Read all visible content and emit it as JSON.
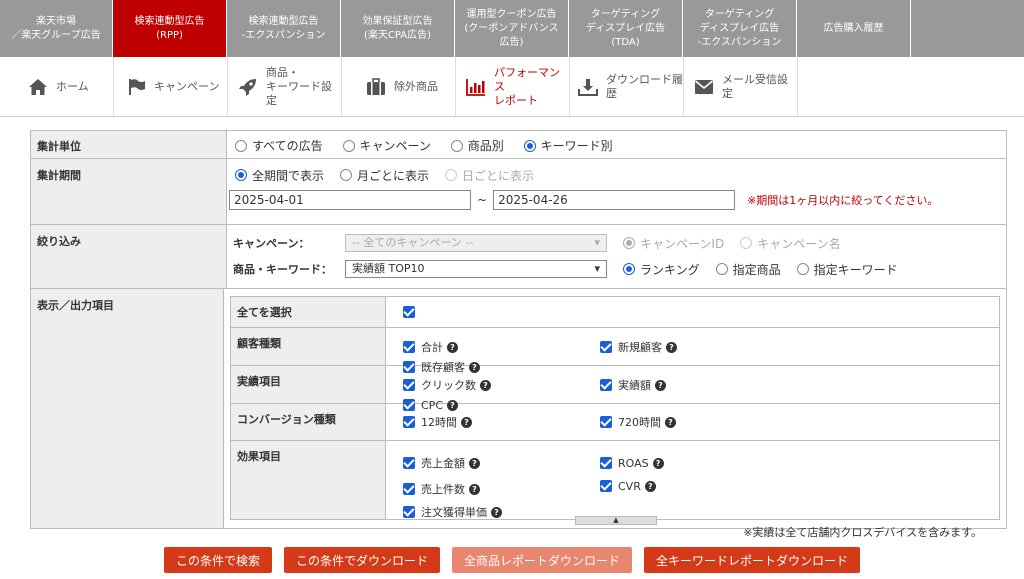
{
  "top_nav": [
    {
      "label": "楽天市場\n／楽天グループ広告",
      "width": 113,
      "active": false
    },
    {
      "label": "検索連動型広告\n(RPP)",
      "width": 114,
      "active": true
    },
    {
      "label": "検索連動型広告\n-エクスパンション",
      "width": 114,
      "active": false
    },
    {
      "label": "効果保証型広告\n(楽天CPA広告)",
      "width": 114,
      "active": false
    },
    {
      "label": "運用型クーポン広告\n(クーポンアドバンス\n広告)",
      "width": 114,
      "active": false
    },
    {
      "label": "ターゲティング\nディスプレイ広告\n(TDA)",
      "width": 114,
      "active": false
    },
    {
      "label": "ターゲティング\nディスプレイ広告\n-エクスパンション",
      "width": 114,
      "active": false
    },
    {
      "label": "広告購入履歴",
      "width": 114,
      "active": false
    }
  ],
  "sub_nav": [
    {
      "label": "ホーム",
      "icon": "home-icon",
      "width": 114
    },
    {
      "label": "キャンペーン",
      "icon": "flag-icon",
      "width": 114
    },
    {
      "label": "商品・\nキーワード設定",
      "icon": "rocket-icon",
      "width": 114
    },
    {
      "label": "除外商品",
      "icon": "briefcase-icon",
      "width": 114
    },
    {
      "label": "パフォーマンス\nレポート",
      "icon": "bar-chart-icon",
      "width": 114,
      "active": true
    },
    {
      "label": "ダウンロード履歴",
      "icon": "download-icon",
      "width": 114
    },
    {
      "label": "メール受信設定",
      "icon": "mail-icon",
      "width": 114
    }
  ],
  "form": {
    "unit": {
      "label": "集計単位",
      "options": [
        "すべての広告",
        "キャンペーン",
        "商品別",
        "キーワード別"
      ],
      "selected": 3
    },
    "period": {
      "label": "集計期間",
      "options": [
        "全期間で表示",
        "月ごとに表示",
        "日ごとに表示"
      ],
      "selected": 0,
      "start": "2025-04-01",
      "tilde": "~",
      "end": "2025-04-26",
      "warning": "※期間は1ヶ月以内に絞ってください。"
    },
    "filter": {
      "label": "絞り込み",
      "campaign_label": "キャンペーン：",
      "campaign_value": "-- 全てのキャンペーン --",
      "campaign_opts": [
        "キャンペーンID",
        "キャンペーン名"
      ],
      "item_label": "商品・キーワード：",
      "item_value": "実績額 TOP10",
      "item_opts": [
        "ランキング",
        "指定商品",
        "指定キーワード"
      ]
    },
    "output": {
      "label": "表示／出力項目",
      "select_all": "全てを選択",
      "groups": [
        {
          "label": "顧客種類",
          "items": [
            "合計",
            "新規顧客",
            "既存顧客"
          ]
        },
        {
          "label": "実績項目",
          "items": [
            "クリック数",
            "実績額",
            "CPC"
          ]
        },
        {
          "label": "コンバージョン種類",
          "items": [
            "12時間",
            "720時間"
          ]
        },
        {
          "label": "効果項目",
          "items": [
            "売上金額",
            "ROAS",
            "売上件数",
            "CVR",
            "注文獲得単価"
          ]
        }
      ],
      "note": "※実績は全て店舗内クロスデバイスを含みます。"
    }
  },
  "buttons": [
    {
      "label": "この条件で検索",
      "light": false
    },
    {
      "label": "この条件でダウンロード",
      "light": false
    },
    {
      "label": "全商品レポートダウンロード",
      "light": true
    },
    {
      "label": "全キーワードレポートダウンロード",
      "light": false
    }
  ],
  "colors": {
    "accent": "#bf0000",
    "button": "#d43a18",
    "check": "#1a5fd8"
  }
}
